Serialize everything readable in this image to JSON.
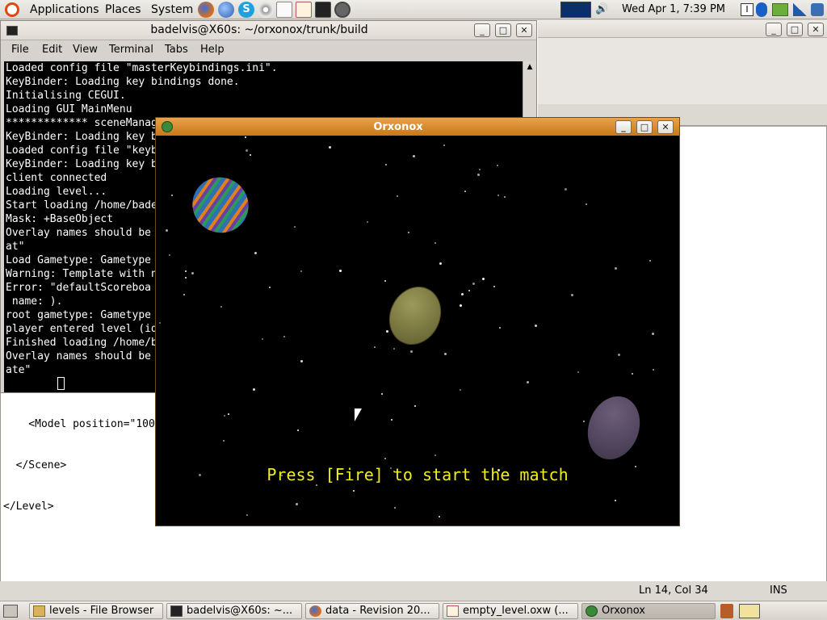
{
  "top_panel": {
    "menus": [
      "Applications",
      "Places",
      "System"
    ],
    "clock": "Wed Apr  1,  7:39 PM"
  },
  "terminal": {
    "title": "badelvis@X60s: ~/orxonox/trunk/build",
    "menus": [
      "File",
      "Edit",
      "View",
      "Terminal",
      "Tabs",
      "Help"
    ],
    "lines": [
      "Loaded config file \"masterKeybindings.ini\".",
      "KeyBinder: Loading key bindings done.",
      "Initialising CEGUI.",
      "Loading GUI MainMenu",
      "************* sceneManager",
      "KeyBinder: Loading key b",
      "Loaded config file \"keyb",
      "KeyBinder: Loading key b",
      "client connected",
      "Loading level...",
      "Start loading /home/bade",
      "Mask: +BaseObject",
      "Overlay names should be",
      "at\"",
      "Load Gametype: Gametype",
      "Warning: Template with n",
      "Error: \"defaultScoreboa",
      " name: ).",
      "root gametype: Gametype",
      "player entered level (id",
      "Finished loading /home/b",
      "Overlay names should be",
      "ate\""
    ]
  },
  "editor": {
    "text_lines": [
      "    <Model position=\"100",
      "  </Scene>",
      "</Level>"
    ],
    "status_position": "Ln 14, Col 34",
    "status_mode": "INS"
  },
  "game": {
    "title": "Orxonox",
    "message": "Press [Fire] to start the match",
    "message_color": "#f0f020"
  },
  "taskbar": {
    "items": [
      {
        "label": "levels - File Browser",
        "icon": "folder-icon"
      },
      {
        "label": "badelvis@X60s: ~...",
        "icon": "terminal-icon"
      },
      {
        "label": "data - Revision 20...",
        "icon": "firefox-icon"
      },
      {
        "label": "empty_level.oxw (...",
        "icon": "text-editor-icon"
      },
      {
        "label": "Orxonox",
        "icon": "orxonox-icon"
      }
    ]
  }
}
